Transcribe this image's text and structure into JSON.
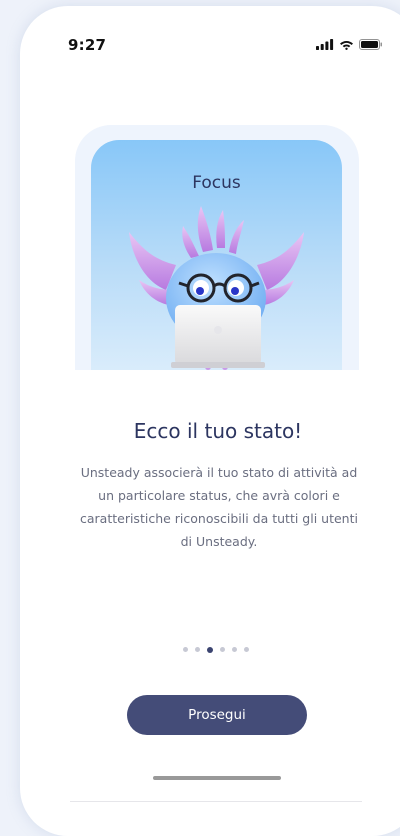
{
  "status_bar": {
    "time": "9:27",
    "icons": [
      "signal-icon",
      "wifi-icon",
      "battery-icon"
    ]
  },
  "onboarding": {
    "card_title": "Focus",
    "headline": "Ecco il tuo stato!",
    "description": "Unsteady associerà il tuo stato di attività ad un particolare status, che avrà colori e caratteristiche riconoscibili da tutti gli utenti di Unsteady.",
    "page_indicator": {
      "total": 6,
      "current": 3
    },
    "cta_label": "Prosegui"
  },
  "colors": {
    "primary": "#444c78",
    "title_text": "#2c3560",
    "body_text": "#6a6e80",
    "card_gradient_top": "#88c7f8",
    "card_gradient_bottom": "#d9ecfb"
  }
}
